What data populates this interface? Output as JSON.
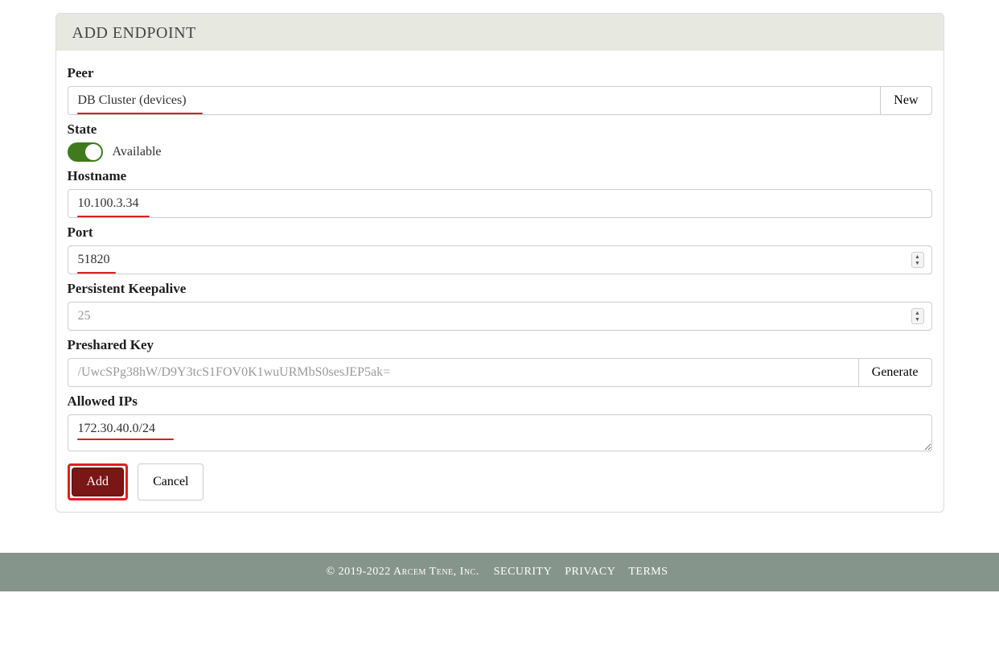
{
  "panel": {
    "title": "Add Endpoint"
  },
  "peer": {
    "label": "Peer",
    "value": "DB Cluster (devices)",
    "new_label": "New"
  },
  "state": {
    "label": "State",
    "status_label": "Available",
    "on": true
  },
  "hostname": {
    "label": "Hostname",
    "value": "10.100.3.34"
  },
  "port": {
    "label": "Port",
    "value": "51820"
  },
  "keepalive": {
    "label": "Persistent Keepalive",
    "placeholder": "25",
    "value": ""
  },
  "psk": {
    "label": "Preshared Key",
    "placeholder": "/UwcSPg38hW/D9Y3tcS1FOV0K1wuURMbS0sesJEP5ak=",
    "value": "",
    "generate_label": "Generate"
  },
  "allowed_ips": {
    "label": "Allowed IPs",
    "value": "172.30.40.0/24"
  },
  "buttons": {
    "add": "Add",
    "cancel": "Cancel"
  },
  "footer": {
    "copyright": "© 2019-2022 Arcem Tene, Inc.",
    "links": [
      "Security",
      "Privacy",
      "Terms"
    ]
  }
}
